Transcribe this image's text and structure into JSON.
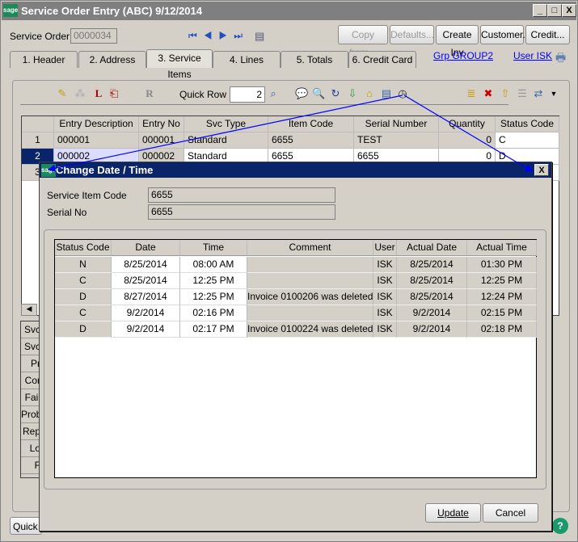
{
  "window": {
    "title": "Service Order Entry (ABC) 9/12/2014",
    "logo": "sage",
    "minimize": "_",
    "maximize": "□",
    "close": "X"
  },
  "header": {
    "service_order_label": "Service Order",
    "service_order_value": "0000034",
    "buttons": [
      "Copy from...",
      "Defaults...",
      "Create Inv",
      "Customer...",
      "Credit..."
    ]
  },
  "tabs": [
    "1. Header",
    "2. Address",
    "3. Service Items",
    "4. Lines",
    "5. Totals",
    "6. Credit Card"
  ],
  "links": {
    "group": "Grp GROUP2",
    "user": "User ISK"
  },
  "toolbar": {
    "quick_row_label": "Quick Row",
    "quick_row_value": "2"
  },
  "grid": {
    "columns": [
      "Entry Description",
      "Entry No",
      "Svc Type",
      "Item Code",
      "Serial Number",
      "Quantity",
      "Status Code"
    ],
    "rows": [
      {
        "num": "1",
        "cells": [
          "000001",
          "000001",
          "Standard",
          "6655",
          "TEST",
          "0",
          "C"
        ]
      },
      {
        "num": "2",
        "cells": [
          "000002",
          "000002",
          "Standard",
          "6655",
          "6655",
          "0",
          "D"
        ]
      },
      {
        "num": "3",
        "cells": [
          "",
          "",
          "",
          "",
          "",
          "",
          ""
        ]
      }
    ]
  },
  "side_tabs": [
    "Svc",
    "Svc",
    "Pr",
    "Cor",
    "Fail",
    "Prob",
    "Rep",
    "Lo",
    "F"
  ],
  "bottom": {
    "quick_label": "Quick"
  },
  "dialog": {
    "title": "Change Date / Time",
    "logo": "sage",
    "close": "X",
    "service_item_code_label": "Service Item Code",
    "service_item_code": "6655",
    "serial_no_label": "Serial No",
    "serial_no": "6655",
    "columns": [
      "Status Code",
      "Date",
      "Time",
      "Comment",
      "User",
      "Actual Date",
      "Actual Time"
    ],
    "rows": [
      [
        "N",
        "8/25/2014",
        "08:00 AM",
        "",
        "ISK",
        "8/25/2014",
        "01:30 PM"
      ],
      [
        "C",
        "8/25/2014",
        "12:25 PM",
        "",
        "ISK",
        "8/25/2014",
        "12:25 PM"
      ],
      [
        "D",
        "8/27/2014",
        "12:25 PM",
        "Invoice 0100206 was deleted",
        "ISK",
        "8/25/2014",
        "12:24 PM"
      ],
      [
        "C",
        "9/2/2014",
        "02:16 PM",
        "",
        "ISK",
        "9/2/2014",
        "02:15 PM"
      ],
      [
        "D",
        "9/2/2014",
        "02:17 PM",
        "Invoice 0100224 was deleted",
        "ISK",
        "9/2/2014",
        "02:18 PM"
      ]
    ],
    "update_label": "Update",
    "cancel_label": "Cancel"
  },
  "colors": {
    "title_bar": "#0a246a",
    "selected_row": "#0a246a",
    "arrow": "#0000ff"
  }
}
